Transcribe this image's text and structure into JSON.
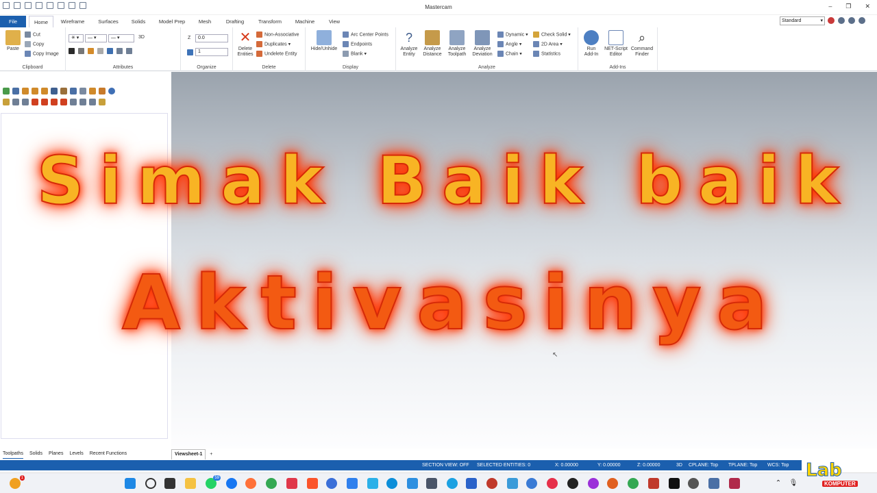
{
  "app": {
    "title": "Mastercam"
  },
  "tabs": [
    "File",
    "Home",
    "Wireframe",
    "Surfaces",
    "Solids",
    "Model Prep",
    "Mesh",
    "Drafting",
    "Transform",
    "Machine",
    "View"
  ],
  "header": {
    "standard_select": "Standard"
  },
  "ribbon": {
    "clipboard": {
      "label": "Clipboard",
      "paste": "Paste",
      "cut": "Cut",
      "copy": "Copy",
      "copy_image": "Copy Image"
    },
    "attributes": {
      "label": "Attributes",
      "mode": "3D"
    },
    "organize": {
      "label": "Organize",
      "z_label": "Z",
      "z_value": "0.0",
      "level_value": "1"
    },
    "delete": {
      "label": "Delete",
      "delete_entities_1": "Delete",
      "delete_entities_2": "Entities",
      "non_associative": "Non-Associative",
      "duplicates": "Duplicates",
      "undelete": "Undelete Entity"
    },
    "display": {
      "label": "Display",
      "hide_unhide": "Hide/Unhide",
      "arc_center": "Arc Center Points",
      "endpoints": "Endpoints",
      "blank": "Blank"
    },
    "analyze": {
      "label": "Analyze",
      "entity_1": "Analyze",
      "entity_2": "Entity",
      "distance_1": "Analyze",
      "distance_2": "Distance",
      "toolpath_1": "Analyze",
      "toolpath_2": "Toolpath",
      "deviation_1": "Analyze",
      "deviation_2": "Deviation",
      "dynamic": "Dynamic",
      "angle": "Angle",
      "chain": "Chain",
      "check_solid": "Check Solid",
      "area_2d": "2D Area",
      "statistics": "Statistics"
    },
    "addins": {
      "label": "Add-Ins",
      "run_1": "Run",
      "run_2": "Add-In",
      "netscript_1": "NET-Script",
      "netscript_2": "Editor",
      "command_1": "Command",
      "command_2": "Finder"
    }
  },
  "left_tabs": [
    "Toolpaths",
    "Solids",
    "Planes",
    "Levels",
    "Recent Functions"
  ],
  "banner": {
    "line1": "Simak Baik baik",
    "line2": "Aktivasinya"
  },
  "viewsheet": {
    "tab": "Viewsheet-1",
    "add": "+"
  },
  "status": {
    "section_view": "SECTION VIEW: OFF",
    "selected": "SELECTED ENTITIES: 0",
    "x": "X:  0.00000",
    "y": "Y:  0.00000",
    "z": "Z:  0.00000",
    "mode": "3D",
    "cplane": "CPLANE: Top",
    "tplane": "TPLANE: Top",
    "wcs": "WCS: Top"
  },
  "taskbar": {
    "badge_count": "59",
    "notif_count": "1"
  },
  "logo": {
    "top": "Lab",
    "bottom": "KOMPUTER"
  },
  "colors": {
    "accent": "#1b5fae",
    "banner_fill": "#f8b424",
    "banner_glow": "#ff3b00"
  }
}
